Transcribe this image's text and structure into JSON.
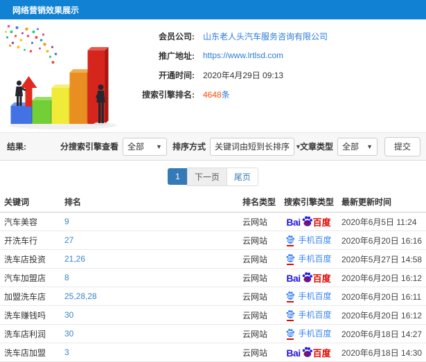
{
  "colors": {
    "header_bg": "#1182d3",
    "link_blue": "#2b7bd9",
    "rank_highlight": "#ff4a00",
    "pagination_active": "#337ab7",
    "baidu_blue": "#2319dc",
    "baidu_red": "#e10601",
    "mobile_baidu_blue": "#3a87f2"
  },
  "titlebar": {
    "title": "网络营销效果展示"
  },
  "illustration": {
    "name": "3d-bar-chart-growth-with-businessmen"
  },
  "info": {
    "member_label": "会员公司:",
    "member_value": "山东老人头汽车服务咨询有限公司",
    "url_label": "推广地址:",
    "url_value": "https://www.lrtlsd.com",
    "open_label": "开通时间:",
    "open_value": "2020年4月29日 09:13",
    "rank_label": "搜索引擎排名:",
    "rank_count": "4648",
    "rank_unit": "条"
  },
  "filters": {
    "result_label": "结果:",
    "engine_filter_label": "分搜索引擎查看",
    "engine_filter_value": "全部",
    "sort_label": "排序方式",
    "sort_value": "关键词由短到长排序",
    "article_type_label": "文章类型",
    "article_type_value": "全部",
    "submit_label": "提交"
  },
  "pagination": {
    "current": "1",
    "next": "下一页",
    "last": "尾页"
  },
  "table": {
    "headers": [
      "关键词",
      "排名",
      "排名类型",
      "搜索引擎类型",
      "最新更新时间"
    ],
    "engine_labels": {
      "baidu_bai": "Bai",
      "baidu_du": "du",
      "baidu_cn": "百度",
      "mobile": "手机百度"
    },
    "rows": [
      {
        "keyword": "汽车美容",
        "rank": "9",
        "rank_type": "云网站",
        "engine": "baidu",
        "updated": "2020年6月5日 11:24"
      },
      {
        "keyword": "开洗车行",
        "rank": "27",
        "rank_type": "云网站",
        "engine": "mobile-baidu",
        "updated": "2020年6月20日 16:16"
      },
      {
        "keyword": "洗车店投资",
        "rank": "21,26",
        "rank_type": "云网站",
        "engine": "mobile-baidu",
        "updated": "2020年5月27日 14:58"
      },
      {
        "keyword": "汽车加盟店",
        "rank": "8",
        "rank_type": "云网站",
        "engine": "baidu",
        "updated": "2020年6月20日 16:12"
      },
      {
        "keyword": "加盟洗车店",
        "rank": "25,28,28",
        "rank_type": "云网站",
        "engine": "mobile-baidu",
        "updated": "2020年6月20日 16:11"
      },
      {
        "keyword": "洗车赚钱吗",
        "rank": "30",
        "rank_type": "云网站",
        "engine": "mobile-baidu",
        "updated": "2020年6月20日 16:12"
      },
      {
        "keyword": "洗车店利润",
        "rank": "30",
        "rank_type": "云网站",
        "engine": "mobile-baidu",
        "updated": "2020年6月18日 14:27"
      },
      {
        "keyword": "洗车店加盟",
        "rank": "3",
        "rank_type": "云网站",
        "engine": "baidu",
        "updated": "2020年6月18日 14:30"
      }
    ]
  }
}
